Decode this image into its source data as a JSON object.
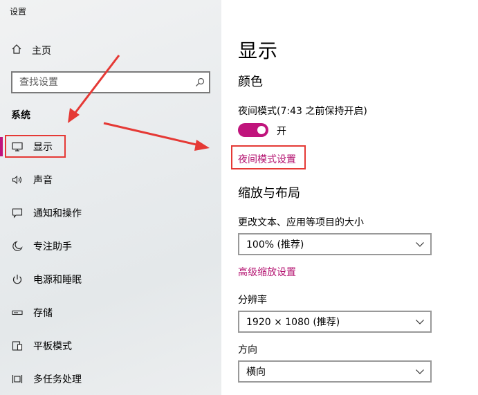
{
  "window": {
    "title": "设置"
  },
  "sidebar": {
    "home_label": "主页",
    "search_placeholder": "查找设置",
    "section_heading": "系统",
    "items": [
      {
        "label": "显示",
        "icon": "monitor-icon",
        "active": true
      },
      {
        "label": "声音",
        "icon": "speaker-icon"
      },
      {
        "label": "通知和操作",
        "icon": "notification-icon"
      },
      {
        "label": "专注助手",
        "icon": "moon-icon"
      },
      {
        "label": "电源和睡眠",
        "icon": "power-icon"
      },
      {
        "label": "存储",
        "icon": "storage-icon"
      },
      {
        "label": "平板模式",
        "icon": "tablet-icon"
      },
      {
        "label": "多任务处理",
        "icon": "multitask-icon"
      }
    ]
  },
  "main": {
    "title": "显示",
    "color_section": {
      "heading": "颜色",
      "night_light_status": "夜间模式(7:43 之前保持开启)",
      "toggle_label": "开",
      "toggle_on": true,
      "night_light_link": "夜间模式设置"
    },
    "scale_section": {
      "heading": "缩放与布局",
      "scale_label": "更改文本、应用等项目的大小",
      "scale_value": "100% (推荐)",
      "advanced_link": "高级缩放设置",
      "resolution_label": "分辨率",
      "resolution_value": "1920 × 1080 (推荐)",
      "orientation_label": "方向",
      "orientation_value": "横向"
    }
  },
  "colors": {
    "accent": "#c0147c",
    "annotation": "#e53935"
  }
}
